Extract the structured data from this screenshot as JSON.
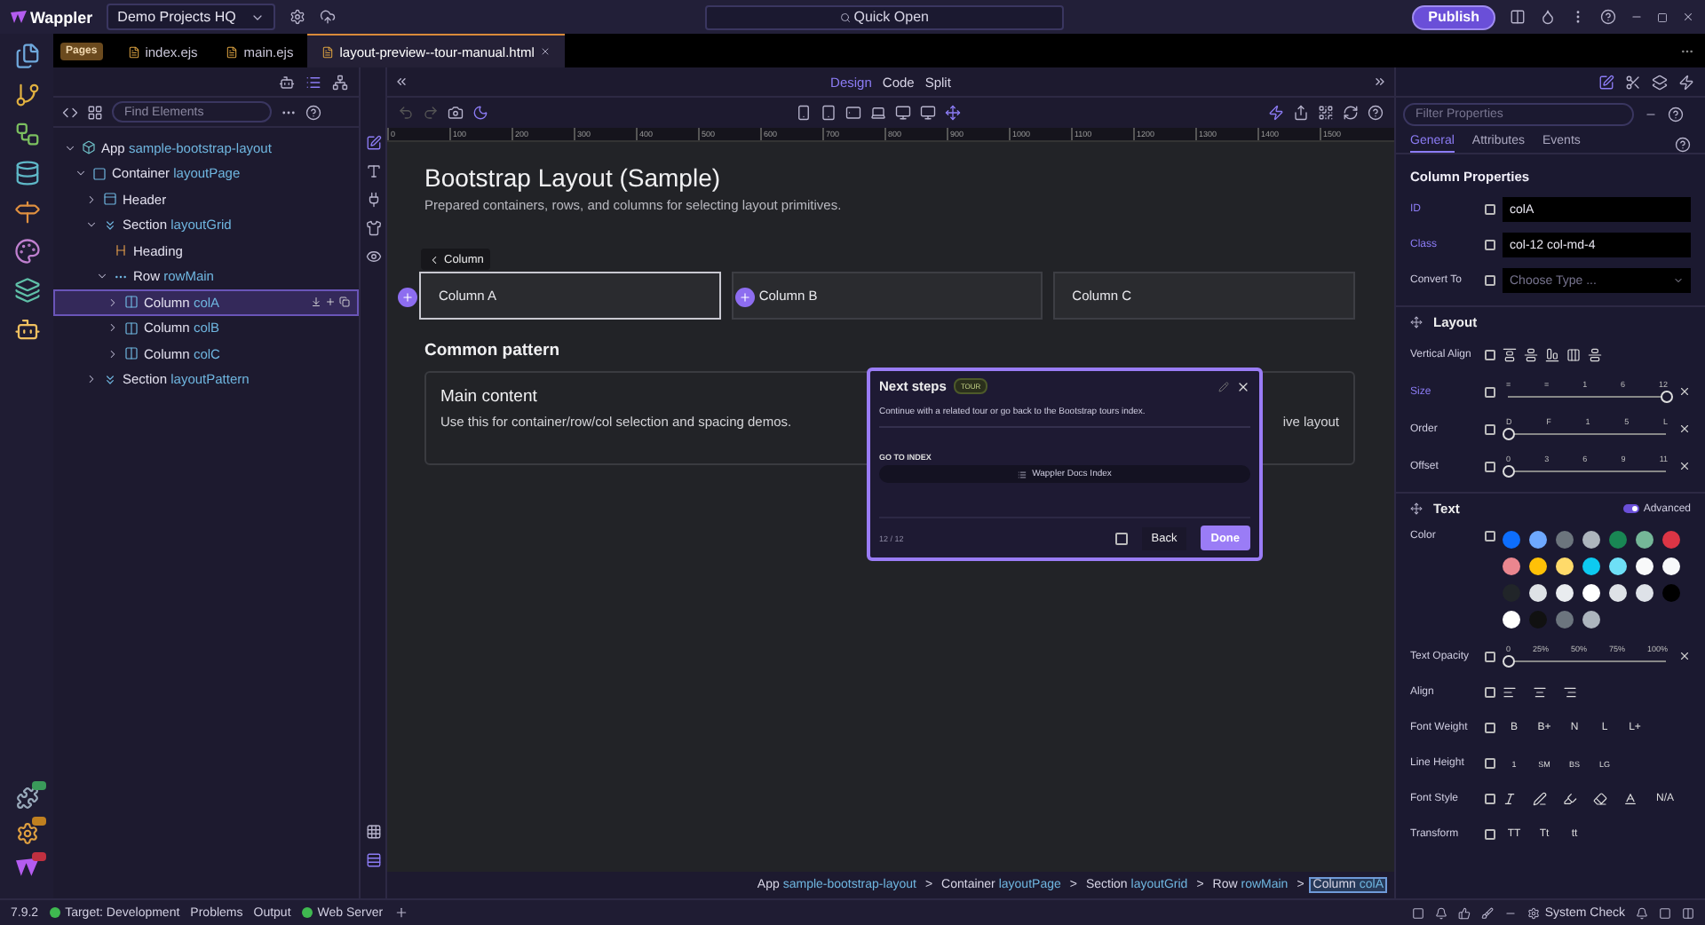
{
  "titlebar": {
    "app_name": "Wappler",
    "project": "Demo Projects HQ",
    "quick_open": "Quick Open",
    "publish": "Publish"
  },
  "file_tabs": {
    "section": "Pages",
    "tabs": [
      {
        "label": "index.ejs",
        "selected": false
      },
      {
        "label": "main.ejs",
        "selected": false
      },
      {
        "label": "layout-preview--tour-manual.html",
        "selected": true
      }
    ]
  },
  "left_panel": {
    "search_placeholder": "Find Elements",
    "tree": [
      {
        "type": "App",
        "id": "sample-bootstrap-layout",
        "kind": "app",
        "expanded": true,
        "selected": false,
        "children": [
          {
            "type": "Container",
            "id": "layoutPage",
            "kind": "container",
            "expanded": true,
            "selected": false,
            "children": [
              {
                "type": "Header",
                "kind": "header",
                "expanded": false,
                "selected": false
              },
              {
                "type": "Section",
                "id": "layoutGrid",
                "kind": "section",
                "expanded": true,
                "selected": false,
                "children": [
                  {
                    "type": "Heading",
                    "kind": "heading",
                    "selected": false
                  },
                  {
                    "type": "Row",
                    "id": "rowMain",
                    "kind": "row",
                    "expanded": true,
                    "selected": false,
                    "children": [
                      {
                        "type": "Column",
                        "id": "colA",
                        "kind": "column",
                        "expanded": false,
                        "selected": true
                      },
                      {
                        "type": "Column",
                        "id": "colB",
                        "kind": "column",
                        "expanded": false,
                        "selected": false
                      },
                      {
                        "type": "Column",
                        "id": "colC",
                        "kind": "column",
                        "expanded": false,
                        "selected": false
                      }
                    ]
                  }
                ]
              },
              {
                "type": "Section",
                "id": "layoutPattern",
                "kind": "section",
                "expanded": false,
                "selected": false
              }
            ]
          }
        ]
      }
    ]
  },
  "view_modes": [
    {
      "label": "Design",
      "selected": true
    },
    {
      "label": "Code",
      "selected": false
    },
    {
      "label": "Split",
      "selected": false
    }
  ],
  "ruler": [
    "0",
    "100",
    "200",
    "300",
    "400",
    "500",
    "600",
    "700",
    "800",
    "900",
    "1000",
    "1100",
    "1200",
    "1300",
    "1400",
    "1500"
  ],
  "page": {
    "title": "Bootstrap Layout (Sample)",
    "subtitle": "Prepared containers, rows, and columns for selecting layout primitives.",
    "crumb_chip": "Column",
    "columns": [
      {
        "label": "Column A",
        "selected": true
      },
      {
        "label": "Column B",
        "selected": false
      },
      {
        "label": "Column C",
        "selected": false
      }
    ],
    "section_heading": "Common pattern",
    "cards": [
      {
        "title": "Main content",
        "text": "Use this for container/row/col selection and spacing demos."
      },
      {
        "text": "ive layout"
      }
    ]
  },
  "tour": {
    "title": "Next steps",
    "badge": "TOUR",
    "text": "Continue with a related tour or go back to the Bootstrap tours index.",
    "section_label": "GO TO INDEX",
    "link": "Wappler Docs Index",
    "progress": "12 / 12",
    "checked": false,
    "back": "Back",
    "done": "Done"
  },
  "breadcrumb": {
    "separator": ">",
    "items": [
      {
        "type": "App",
        "id": "sample-bootstrap-layout",
        "selected": false
      },
      {
        "type": "Container",
        "id": "layoutPage",
        "selected": false
      },
      {
        "type": "Section",
        "id": "layoutGrid",
        "selected": false
      },
      {
        "type": "Row",
        "id": "rowMain",
        "selected": false
      },
      {
        "type": "Column",
        "id": "colA",
        "selected": true
      }
    ]
  },
  "properties": {
    "search_placeholder": "Filter Properties",
    "tabs": [
      {
        "label": "General",
        "selected": true
      },
      {
        "label": "Attributes",
        "selected": false
      },
      {
        "label": "Events",
        "selected": false
      }
    ],
    "heading": "Column Properties",
    "fields": [
      {
        "label": "ID",
        "kind": "input",
        "set": true,
        "value": "colA"
      },
      {
        "label": "Class",
        "kind": "input",
        "set": true,
        "value": "col-12 col-md-4"
      },
      {
        "label": "Convert To",
        "kind": "select",
        "set": false,
        "placeholder": "Choose Type ..."
      }
    ],
    "layout": {
      "title": "Layout",
      "vertical_align": "Vertical Align",
      "sliders": [
        {
          "label": "Size",
          "set": true,
          "ticks": [
            "=",
            "=",
            "1",
            "6",
            "12"
          ],
          "level": 1
        },
        {
          "label": "Order",
          "set": false,
          "ticks": [
            "D",
            "F",
            "1",
            "5",
            "L"
          ],
          "level": 0
        },
        {
          "label": "Offset",
          "set": false,
          "ticks": [
            "0",
            "3",
            "6",
            "9",
            "11"
          ],
          "level": 0
        }
      ]
    },
    "text": {
      "title": "Text",
      "advanced": {
        "label": "Advanced",
        "on": true
      },
      "color_label": "Color",
      "colors": [
        {
          "color": "#0d6efd"
        },
        {
          "color": "#6ea8fe"
        },
        {
          "color": "#6c757d"
        },
        {
          "color": "#adb5bd"
        },
        {
          "color": "#198754"
        },
        {
          "color": "#75b798"
        },
        {
          "color": "#dc3545"
        },
        {
          "color": "#ea868f"
        },
        {
          "color": "#ffc107"
        },
        {
          "color": "#ffda6a"
        },
        {
          "color": "#0dcaf0"
        },
        {
          "color": "#6edff6"
        },
        {
          "color": "#f8f9fa"
        },
        {
          "color": "#f8f9fb"
        },
        {
          "color": "#212529"
        },
        {
          "color": "#dee2e6"
        },
        {
          "color": "#e9ecef"
        },
        {
          "color": "#ffffff"
        },
        {
          "color": "#dee2e7"
        },
        {
          "color": "#dee2e8"
        },
        {
          "color": "#000000"
        },
        {
          "color": "#fffffe"
        },
        {
          "color": "#111111"
        },
        {
          "color": "#6c757e"
        },
        {
          "color": "#adb5be"
        }
      ],
      "opacity": {
        "label": "Text Opacity",
        "ticks": [
          "0",
          "25%",
          "50%",
          "75%",
          "100%"
        ],
        "level": 0
      },
      "rows": [
        {
          "label": "Align",
          "kind": "align"
        },
        {
          "label": "Font Weight",
          "kind": "options",
          "options": [
            "B",
            "B+",
            "N",
            "L",
            "L+"
          ]
        },
        {
          "label": "Line Height",
          "kind": "options",
          "options": [
            "1",
            "SM",
            "BS",
            "LG"
          ]
        },
        {
          "label": "Font Style",
          "kind": "style",
          "options": [
            "N/A"
          ]
        },
        {
          "label": "Transform",
          "kind": "options",
          "options": [
            "TT",
            "Tt",
            "tt"
          ]
        }
      ]
    }
  },
  "status_bar": {
    "version": "7.9.2",
    "items": [
      {
        "label": "Target: Development",
        "kind": "status",
        "color": "#3fb950"
      },
      {
        "label": "Problems",
        "kind": "plain"
      },
      {
        "label": "Output",
        "kind": "plain"
      },
      {
        "label": "Web Server",
        "kind": "status",
        "color": "#3fb950"
      }
    ],
    "system_check": "System Check"
  }
}
